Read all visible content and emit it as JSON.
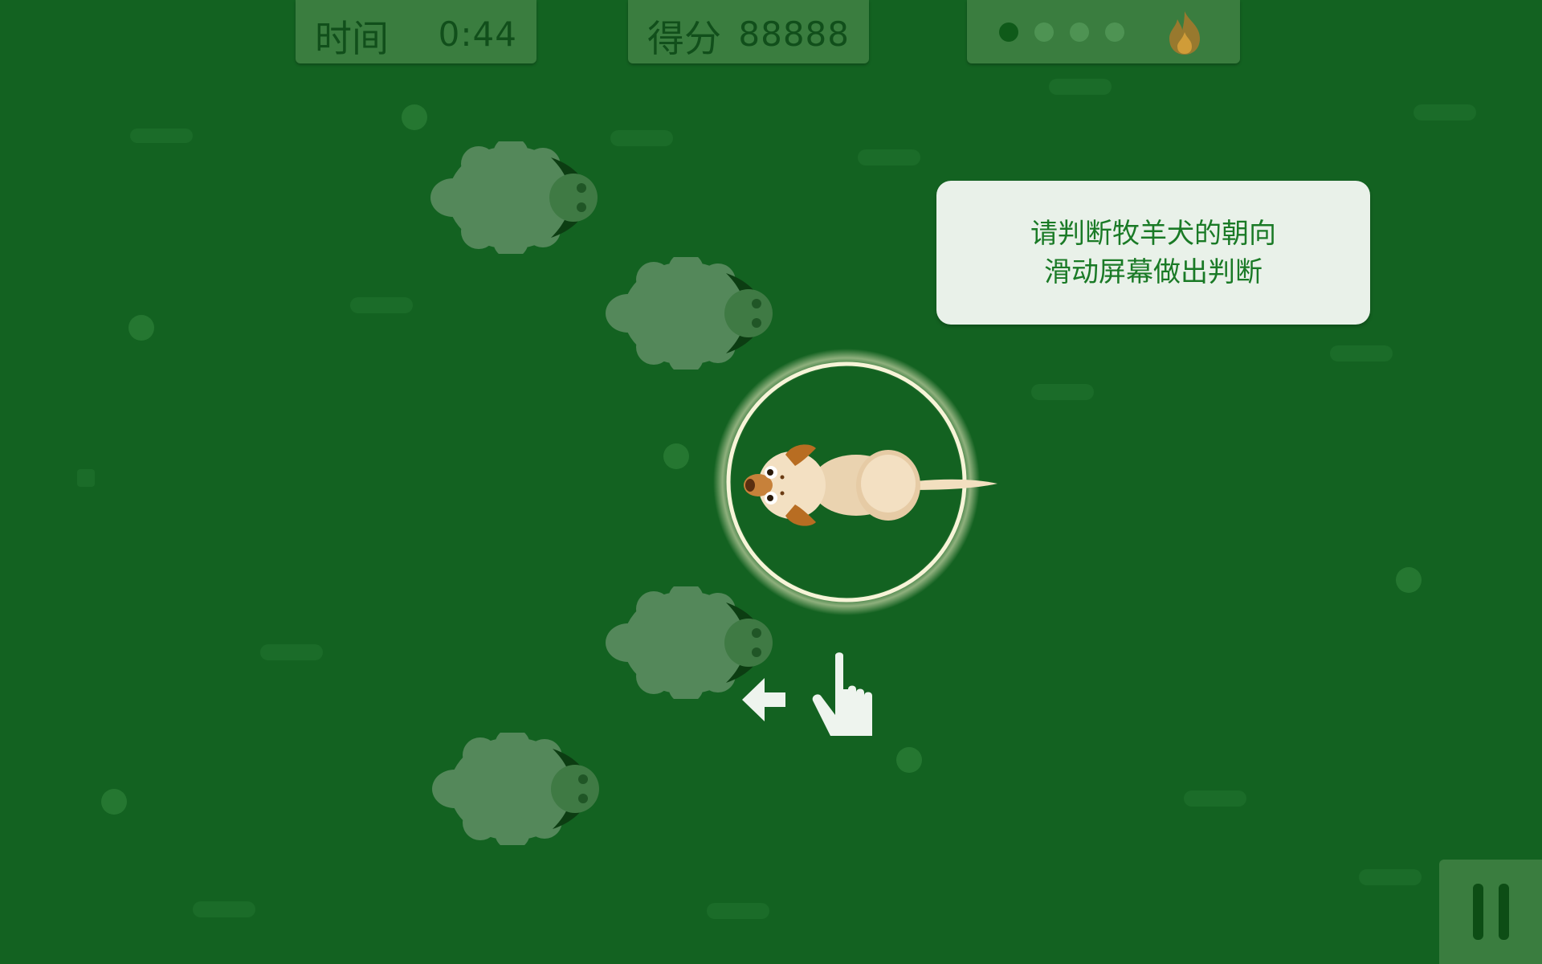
{
  "hud": {
    "time_label": "时间",
    "time_value": "0:44",
    "score_label": "得分",
    "score_value": "88888",
    "lives": [
      true,
      false,
      false,
      false
    ],
    "flame_icon": "flame-icon"
  },
  "tooltip": {
    "line1": "请判断牧羊犬的朝向",
    "line2": "滑动屏幕做出判断"
  },
  "gesture": {
    "direction": "left",
    "arrow_icon": "arrow-left-icon",
    "hand_icon": "pointing-hand-icon"
  },
  "sheep_facing": "right",
  "dog_facing": "left",
  "pause_icon": "pause-icon",
  "colors": {
    "background": "#136221",
    "panel": "#3a7d3f",
    "text_green": "#1a7a26",
    "glow": "#f4f0c8"
  }
}
